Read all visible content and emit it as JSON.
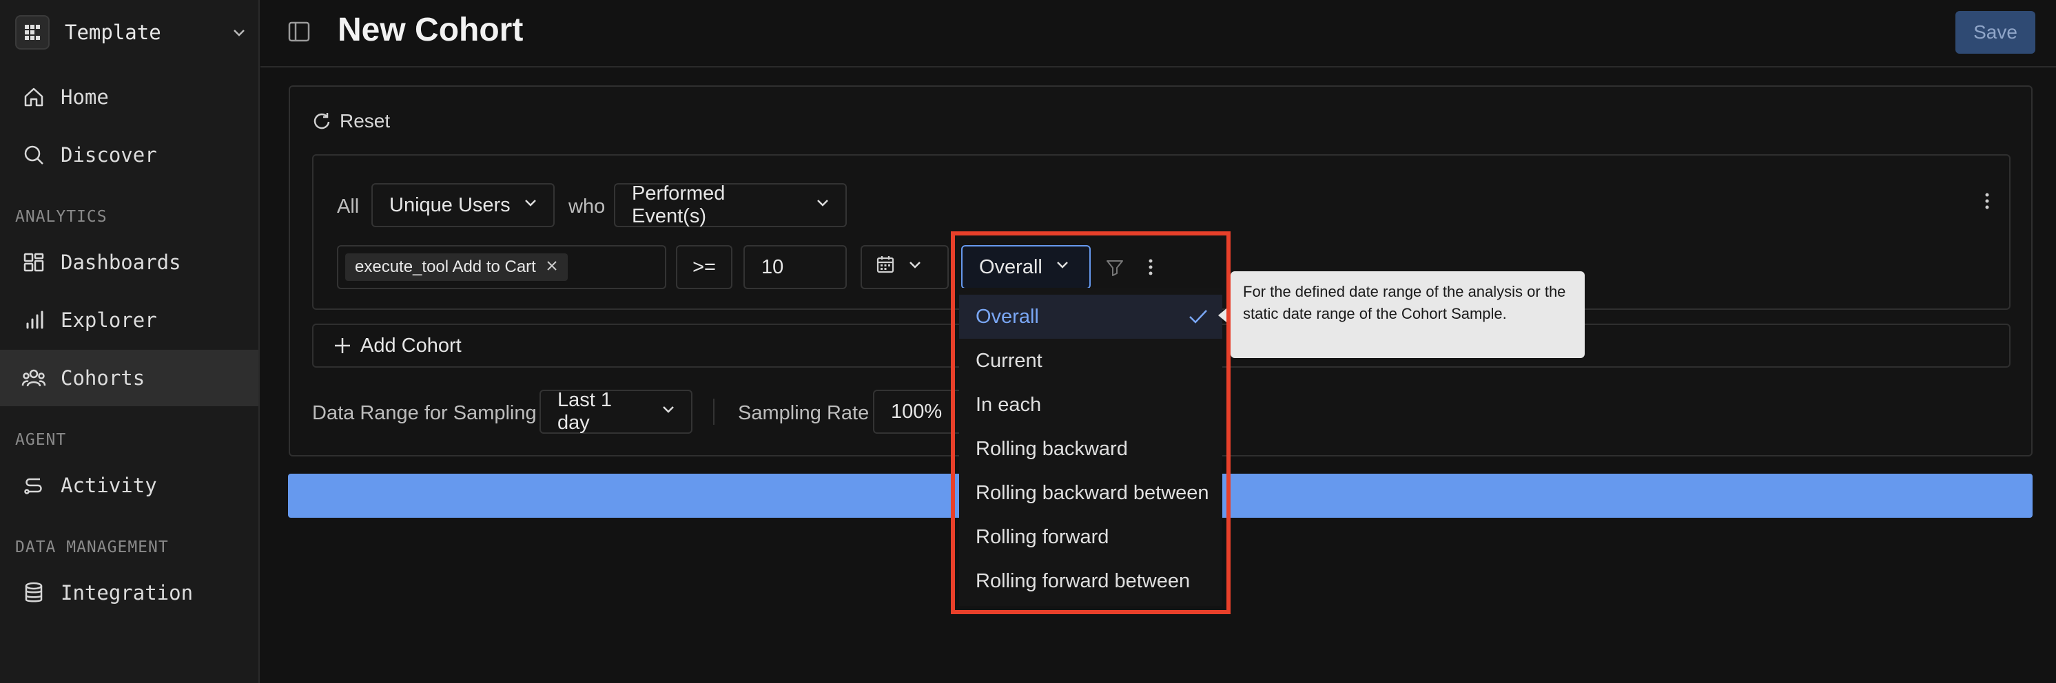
{
  "workspace": {
    "name": "Template"
  },
  "nav": {
    "home": "Home",
    "discover": "Discover",
    "section_analytics": "ANALYTICS",
    "dashboards": "Dashboards",
    "explorer": "Explorer",
    "cohorts": "Cohorts",
    "section_agent": "AGENT",
    "activity": "Activity",
    "section_data": "DATA MANAGEMENT",
    "integration": "Integration"
  },
  "header": {
    "title": "New Cohort",
    "save_label": "Save"
  },
  "builder": {
    "reset_label": "Reset",
    "all_label": "All",
    "unit_value": "Unique Users",
    "who_label": "who",
    "action_value": "Performed Event(s)",
    "event_chip": "execute_tool Add to Cart",
    "operator": ">=",
    "count_value": "10",
    "range_mode_value": "Overall",
    "add_cohort_label": "Add Cohort",
    "sampling_range_label": "Data Range for Sampling",
    "sampling_range_value": "Last 1 day",
    "sampling_rate_label": "Sampling Rate",
    "sampling_rate_value": "100%"
  },
  "dropdown": {
    "options": [
      "Overall",
      "Current",
      "In each",
      "Rolling backward",
      "Rolling backward between",
      "Rolling forward",
      "Rolling forward between"
    ],
    "selected": "Overall"
  },
  "tooltip": {
    "text": "For the defined date range of the analysis or the static date range of the Cohort Sample."
  },
  "colors": {
    "accent": "#6699ee",
    "highlight_border": "#e8402a",
    "selected_text": "#7aa7f5"
  }
}
